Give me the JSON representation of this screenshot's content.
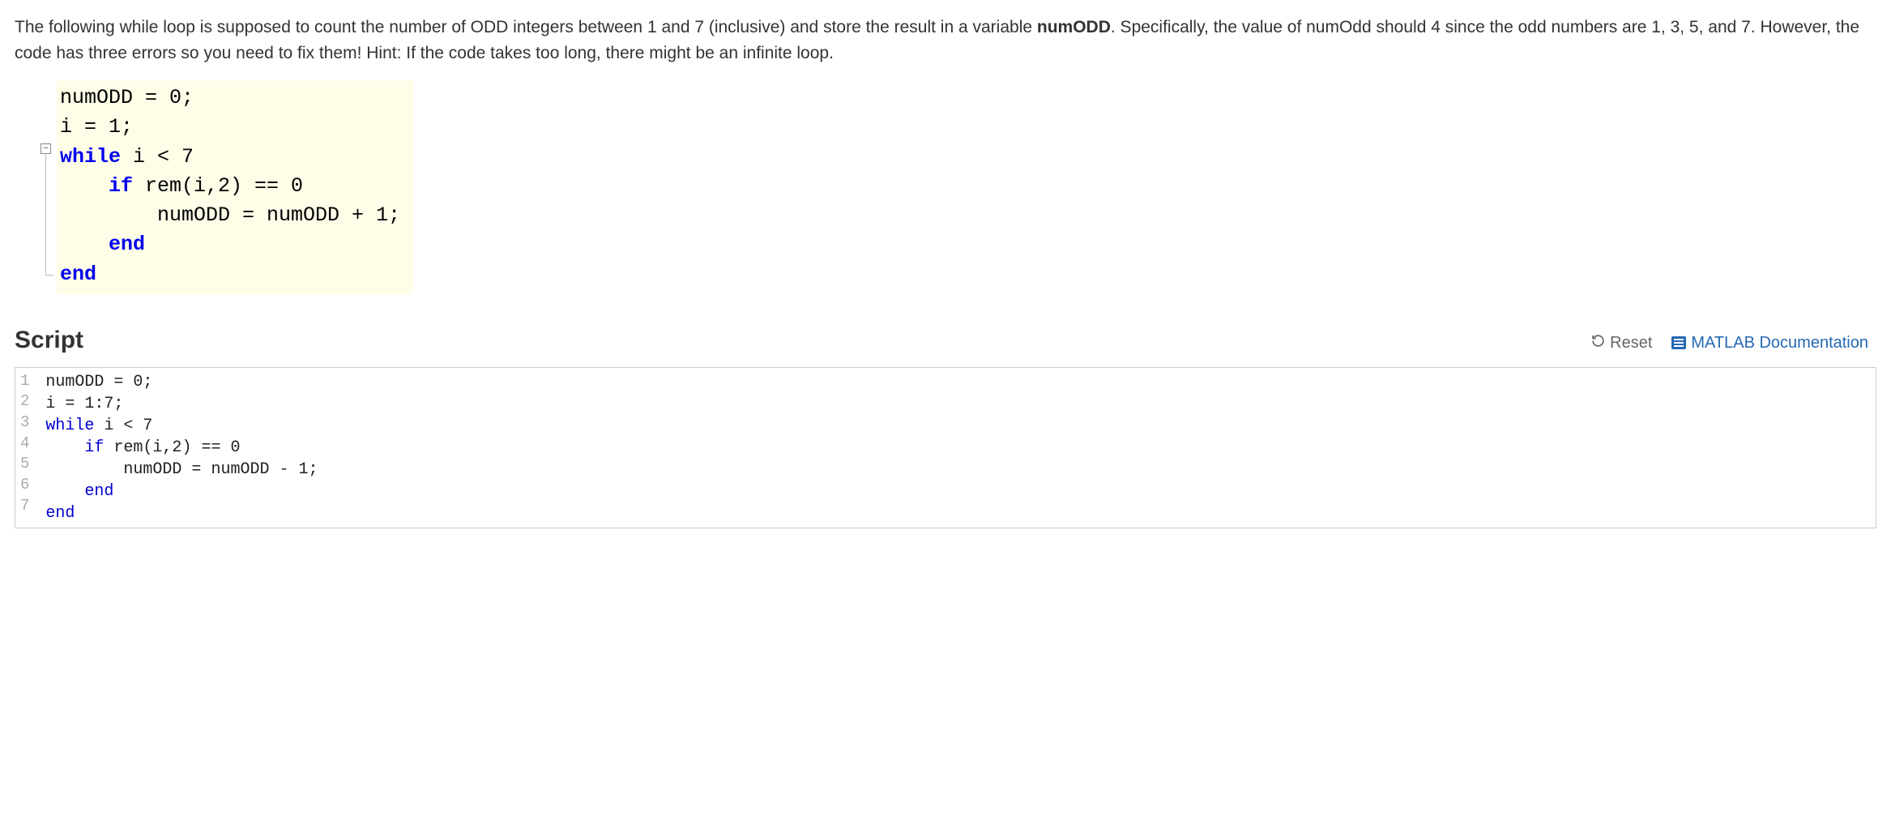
{
  "problem": {
    "sentence_a": "The following while loop is supposed to count the number of ODD integers  between 1 and 7 (inclusive) and store the result in a variable ",
    "bold_var": "numODD",
    "sentence_b": ".   Specifically, the value of numOdd should 4 since the odd numbers are 1, 3, 5, and 7. However, the code has three errors so you need to fix them! Hint: If the code takes too long, there might be an infinite loop."
  },
  "reference_code": {
    "l1": "numODD = 0;",
    "l2": "i = 1;",
    "l3a": "while",
    "l3b": " i < 7",
    "l4a": "    if",
    "l4b": " rem(i,2) == 0",
    "l5": "        numODD = numODD + 1;",
    "l6": "    end",
    "l7": "end"
  },
  "script": {
    "title": "Script",
    "reset_label": "Reset",
    "doc_label": "MATLAB Documentation"
  },
  "editor": {
    "line_numbers": [
      "1",
      "2",
      "3",
      "4",
      "5",
      "6",
      "7"
    ],
    "lines": {
      "l1": "numODD = 0;",
      "l2": "i = 1:7;",
      "l3a": "while",
      "l3b": " i < 7",
      "l4a": "    if",
      "l4b": " rem(i,2) == 0",
      "l5": "        numODD = numODD - 1;",
      "l6a": "    ",
      "l6b": "end",
      "l7": "end"
    }
  }
}
